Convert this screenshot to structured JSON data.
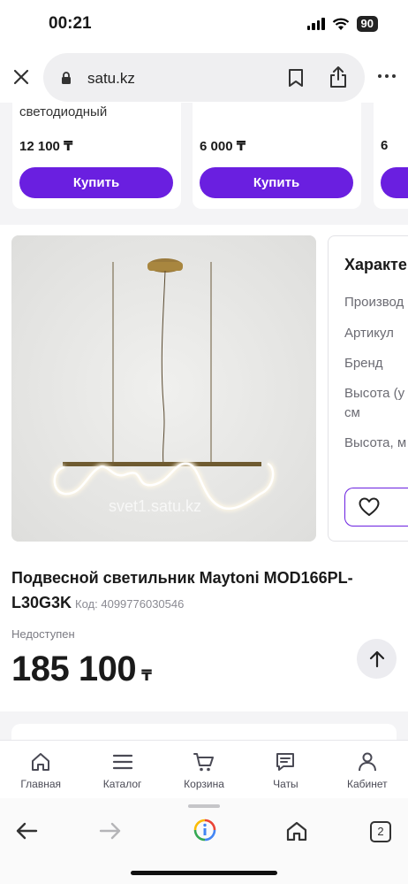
{
  "status_bar": {
    "time": "00:21",
    "battery": "90"
  },
  "browser": {
    "url": "satu.kz",
    "tab_count": "2"
  },
  "product_strip": [
    {
      "name": "светодиодный",
      "price": "12 100 ₸",
      "buy_label": "Купить"
    },
    {
      "name": "",
      "price": "6 000 ₸",
      "buy_label": "Купить"
    },
    {
      "name": "",
      "price": "6 ",
      "buy_label": ""
    }
  ],
  "image": {
    "watermark": "svet1.satu.kz"
  },
  "specs": {
    "heading": "Характе",
    "rows": [
      "Производ",
      "Артикул",
      "Бренд",
      "Высота (у",
      "см",
      "Высота, м"
    ]
  },
  "product": {
    "title": "Подвесной светильник Maytoni MOD166PL-L30G3K",
    "code": "Код: 4099776030546",
    "availability": "Недоступен",
    "price": "185 100",
    "currency": "₸"
  },
  "tabbar": {
    "items": [
      {
        "label": "Главная",
        "icon": "home-icon"
      },
      {
        "label": "Каталог",
        "icon": "menu-icon"
      },
      {
        "label": "Корзина",
        "icon": "cart-icon"
      },
      {
        "label": "Чаты",
        "icon": "chat-icon"
      },
      {
        "label": "Кабинет",
        "icon": "user-icon"
      }
    ]
  },
  "colors": {
    "accent": "#6a1fe0",
    "background_gray": "#f4f4f6"
  }
}
